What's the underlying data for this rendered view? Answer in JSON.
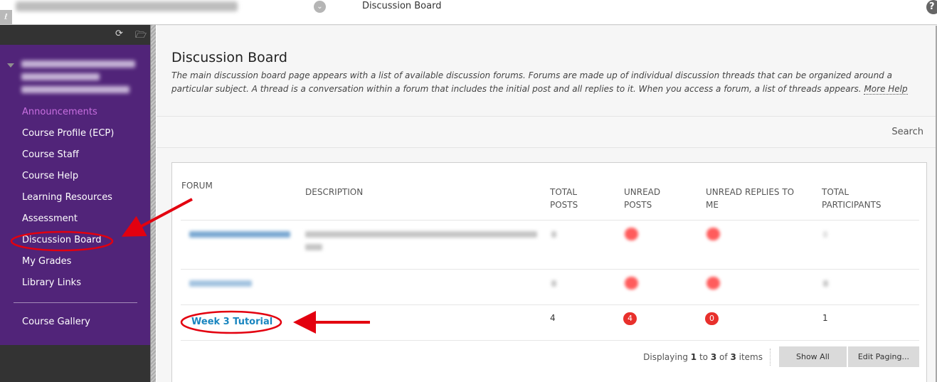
{
  "topbar": {
    "course_name": "[blurred course name]",
    "breadcrumb_current": "Discussion Board",
    "help_icon": "?"
  },
  "sidebar": {
    "tools": {
      "refresh_icon": "refresh-icon",
      "folder_icon": "folder-icon"
    },
    "course_title": "[blurred course title]",
    "items": [
      {
        "label": "Announcements",
        "active": true
      },
      {
        "label": "Course Profile (ECP)"
      },
      {
        "label": "Course Staff"
      },
      {
        "label": "Course Help"
      },
      {
        "label": "Learning Resources"
      },
      {
        "label": "Assessment"
      },
      {
        "label": "Discussion Board",
        "highlighted": true
      },
      {
        "label": "My Grades"
      },
      {
        "label": "Library Links"
      }
    ],
    "secondary_items": [
      {
        "label": "Course Gallery"
      }
    ]
  },
  "main": {
    "title": "Discussion Board",
    "description": "The main discussion board page appears with a list of available discussion forums. Forums are made up of individual discussion threads that can be organized around a particular subject. A thread is a conversation within a forum that includes the initial post and all replies to it. When you access a forum, a list of threads appears.",
    "more_help": "More Help",
    "search_label": "Search",
    "table": {
      "columns": [
        "FORUM",
        "DESCRIPTION",
        "TOTAL POSTS",
        "UNREAD POSTS",
        "UNREAD REPLIES TO ME",
        "TOTAL PARTICIPANTS"
      ],
      "rows": [
        {
          "forum": "Assessment Questions",
          "description": "Share any questions you have about each assessment task",
          "total_posts": "",
          "unread_posts": "",
          "unread_replies": "",
          "participants": "",
          "blurred": true
        },
        {
          "forum": "Reflection Task",
          "description": "",
          "total_posts": "",
          "unread_posts": "",
          "unread_replies": "",
          "participants": "",
          "blurred": true
        },
        {
          "forum": "Week 3 Tutorial",
          "description": "",
          "total_posts": "4",
          "unread_posts": "4",
          "unread_replies": "0",
          "participants": "1",
          "highlighted": true
        }
      ]
    },
    "paging": {
      "prefix": "Displaying",
      "from": "1",
      "to_word": "to",
      "to": "3",
      "of_word": "of",
      "total": "3",
      "suffix": "items",
      "show_all": "Show All",
      "edit_paging": "Edit Paging..."
    }
  },
  "colors": {
    "sidebar_purple": "#512479",
    "active_item": "#c86fe0",
    "link_blue": "#1a86c0",
    "badge_red": "#e8302c",
    "annotation_red": "#e3000f"
  }
}
